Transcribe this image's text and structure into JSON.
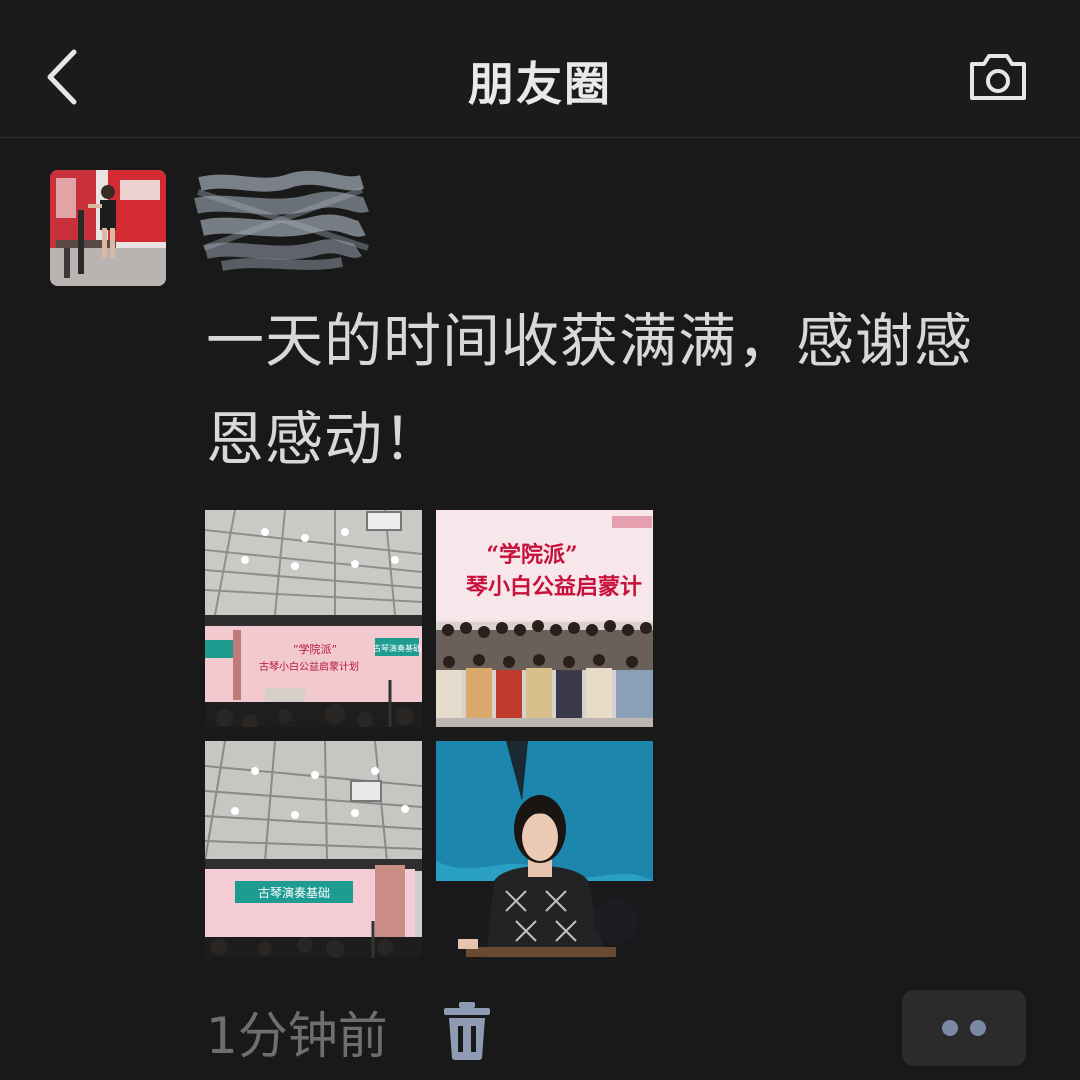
{
  "navbar": {
    "title": "朋友圈",
    "back_icon": "chevron-left-icon",
    "camera_icon": "camera-icon"
  },
  "post": {
    "text": "一天的时间收获满满，感谢感恩感动！",
    "photos": [
      {
        "screen_title": "“学院派”",
        "screen_subtitle": "古琴小白公益启蒙计划",
        "side_panel": "古琴演奏基础"
      },
      {
        "banner_title": "“学院派”",
        "banner_subtitle": "琴小白公益启蒙计"
      },
      {
        "screen_text": "古琴演奏基础"
      },
      {}
    ],
    "time": "1分钟前",
    "delete_icon": "trash-icon",
    "more_icon": "more-dots-icon"
  },
  "colors": {
    "background": "#191919",
    "text": "#d8d8d8",
    "muted": "#6e6e6e",
    "accent_dots": "#7a8aa5"
  }
}
